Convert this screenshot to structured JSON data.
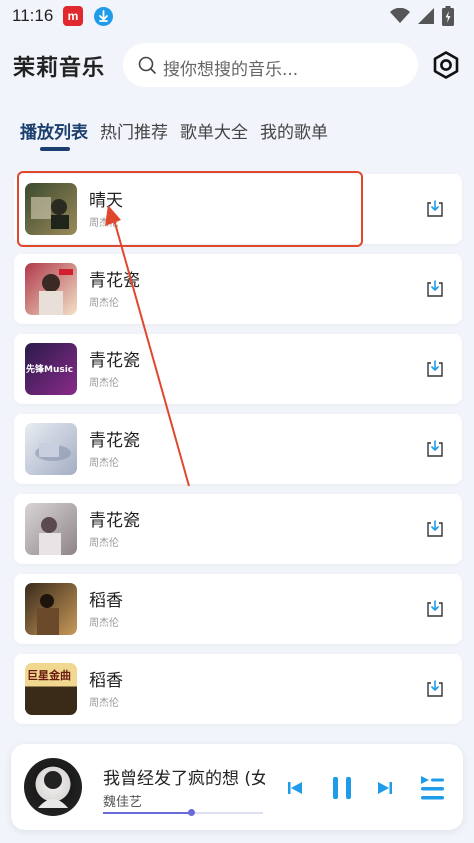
{
  "status_bar": {
    "time": "11:16",
    "app_badge": "m",
    "icons": [
      "download-notification-icon",
      "wifi-icon",
      "signal-icon",
      "battery-charging-icon"
    ]
  },
  "header": {
    "title": "茉莉音乐",
    "search_placeholder": "搜你想搜的音乐..."
  },
  "tabs": [
    {
      "label": "播放列表",
      "active": true
    },
    {
      "label": "热门推荐",
      "active": false
    },
    {
      "label": "歌单大全",
      "active": false
    },
    {
      "label": "我的歌单",
      "active": false
    }
  ],
  "songs": [
    {
      "title": "晴天",
      "artist": "周杰伦",
      "cover_colors": [
        "#3a4a2e",
        "#9c8a5a"
      ]
    },
    {
      "title": "青花瓷",
      "artist": "周杰伦",
      "cover_colors": [
        "#b0394a",
        "#f2e2c8"
      ]
    },
    {
      "title": "青花瓷",
      "artist": "周杰伦",
      "cover_colors": [
        "#2a1b4a",
        "#8a2a8a"
      ],
      "cover_text": "先锋Music"
    },
    {
      "title": "青花瓷",
      "artist": "周杰伦",
      "cover_colors": [
        "#d8dde8",
        "#a4aec4"
      ]
    },
    {
      "title": "青花瓷",
      "artist": "周杰伦",
      "cover_colors": [
        "#c8c4c6",
        "#8e8488"
      ]
    },
    {
      "title": "稻香",
      "artist": "周杰伦",
      "cover_colors": [
        "#3a2a1a",
        "#c89a5a"
      ]
    },
    {
      "title": "稻香",
      "artist": "周杰伦",
      "cover_colors": [
        "#f0d890",
        "#3a2a18"
      ],
      "cover_text": "巨星金曲"
    }
  ],
  "player": {
    "title": "我曾经发了疯的想 (女",
    "artist": "魏佳艺",
    "progress": 0.55
  },
  "colors": {
    "accent": "#1e9be9",
    "tab_active": "#1b3f6e",
    "highlight": "#e0482e",
    "arrow": "#e0482e"
  }
}
